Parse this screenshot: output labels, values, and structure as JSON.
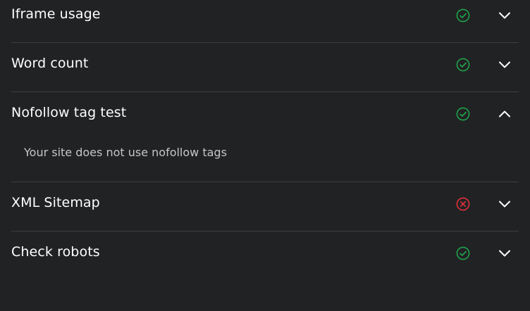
{
  "colors": {
    "background": "#212224",
    "divider": "#3d3e40",
    "pass": "#1fa34a",
    "fail": "#e0303a",
    "text": "#ffffff",
    "muted_text": "#c6c6c8"
  },
  "checks": [
    {
      "title": "Iframe usage",
      "status": "pass",
      "status_icon": "check-circle-icon",
      "expanded": false,
      "chevron_icon": "chevron-down-icon",
      "detail": ""
    },
    {
      "title": "Word count",
      "status": "pass",
      "status_icon": "check-circle-icon",
      "expanded": false,
      "chevron_icon": "chevron-down-icon",
      "detail": ""
    },
    {
      "title": "Nofollow tag test",
      "status": "pass",
      "status_icon": "check-circle-icon",
      "expanded": true,
      "chevron_icon": "chevron-up-icon",
      "detail": "Your site does not use nofollow tags"
    },
    {
      "title": "XML Sitemap",
      "status": "fail",
      "status_icon": "x-circle-icon",
      "expanded": false,
      "chevron_icon": "chevron-down-icon",
      "detail": ""
    },
    {
      "title": "Check robots",
      "status": "pass",
      "status_icon": "check-circle-icon",
      "expanded": false,
      "chevron_icon": "chevron-down-icon",
      "detail": ""
    }
  ]
}
